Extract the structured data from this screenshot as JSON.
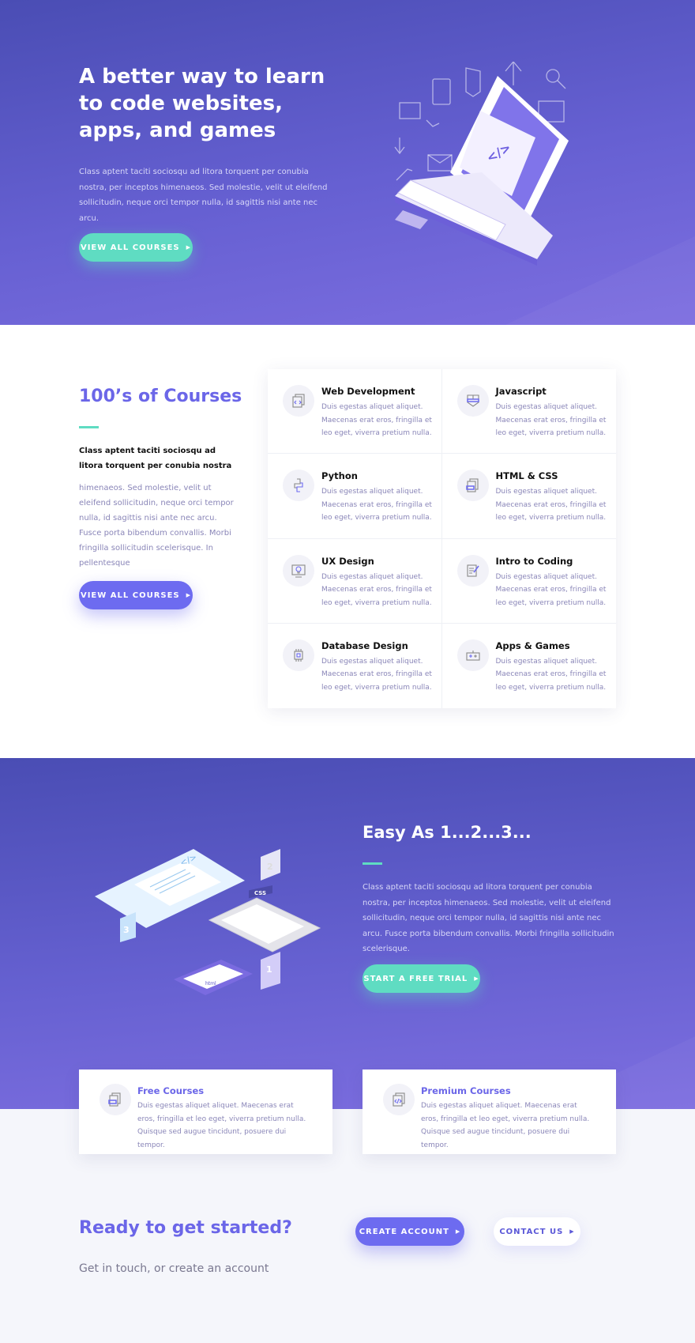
{
  "hero": {
    "title": "A better way to learn to code websites, apps, and games",
    "text": "Class aptent taciti sociosqu ad litora torquent per conubia nostra, per inceptos himenaeos. Sed molestie, velit ut eleifend sollicitudin, neque orci tempor nulla, id sagittis nisi ante nec arcu.",
    "button": "VIEW ALL COURSES"
  },
  "courses": {
    "title": "100’s of Courses",
    "lead": "Class aptent taciti sociosqu ad litora torquent per conubia nostra",
    "text": "himenaeos. Sed molestie, velit ut eleifend sollicitudin, neque orci tempor nulla, id sagittis nisi ante nec arcu. Fusce porta bibendum convallis. Morbi fringilla sollicitudin scelerisque. In pellentesque",
    "button": "VIEW ALL COURSES",
    "items": [
      {
        "title": "Web Development",
        "text": "Duis egestas aliquet aliquet. Maecenas erat eros, fringilla et leo eget, viverra pretium nulla.",
        "icon": "code-window-icon"
      },
      {
        "title": "Javascript",
        "text": "Duis egestas aliquet aliquet. Maecenas erat eros, fringilla et leo eget, viverra pretium nulla.",
        "icon": "shield-icon"
      },
      {
        "title": "Python",
        "text": "Duis egestas aliquet aliquet. Maecenas erat eros, fringilla et leo eget, viverra pretium nulla.",
        "icon": "python-icon"
      },
      {
        "title": "HTML & CSS",
        "text": "Duis egestas aliquet aliquet. Maecenas erat eros, fringilla et leo eget, viverra pretium nulla.",
        "icon": "files-icon"
      },
      {
        "title": "UX Design",
        "text": "Duis egestas aliquet aliquet. Maecenas erat eros, fringilla et leo eget, viverra pretium nulla.",
        "icon": "lightbulb-monitor-icon"
      },
      {
        "title": "Intro to Coding",
        "text": "Duis egestas aliquet aliquet. Maecenas erat eros, fringilla et leo eget, viverra pretium nulla.",
        "icon": "document-pen-icon"
      },
      {
        "title": "Database Design",
        "text": "Duis egestas aliquet aliquet. Maecenas erat eros, fringilla et leo eget, viverra pretium nulla.",
        "icon": "chip-icon"
      },
      {
        "title": "Apps & Games",
        "text": "Duis egestas aliquet aliquet. Maecenas erat eros, fringilla et leo eget, viverra pretium nulla.",
        "icon": "gamepad-icon"
      }
    ]
  },
  "steps": {
    "title": "Easy As 1...2...3...",
    "text": "Class aptent taciti sociosqu ad litora torquent per conubia nostra, per inceptos himenaeos. Sed molestie, velit ut eleifend sollicitudin, neque orci tempor nulla, id sagittis nisi ante nec arcu. Fusce porta bibendum convallis. Morbi fringilla sollicitudin scelerisque.",
    "button": "START A FREE TRIAL",
    "illustration": {
      "labels": [
        "1",
        "2",
        "3",
        "CSS",
        "html"
      ]
    }
  },
  "plans": [
    {
      "title": "Free Courses",
      "text": "Duis egestas aliquet aliquet. Maecenas erat eros, fringilla et leo eget, viverra pretium nulla. Quisque sed augue tincidunt, posuere dui tempor.",
      "icon": "files-icon"
    },
    {
      "title": "Premium Courses",
      "text": "Duis egestas aliquet aliquet. Maecenas erat eros, fringilla et leo eget, viverra pretium nulla. Quisque sed augue tincidunt, posuere dui tempor.",
      "icon": "code-window-icon"
    }
  ],
  "cta": {
    "title": "Ready to get started?",
    "subtitle": "Get in touch, or create an account",
    "create": "CREATE ACCOUNT",
    "contact": "CONTACT US"
  },
  "colors": {
    "primary": "#6d6bf0",
    "accent": "#5fdcc2",
    "hero_dark": "#4a4db4",
    "hero_light": "#7d6ee0"
  }
}
